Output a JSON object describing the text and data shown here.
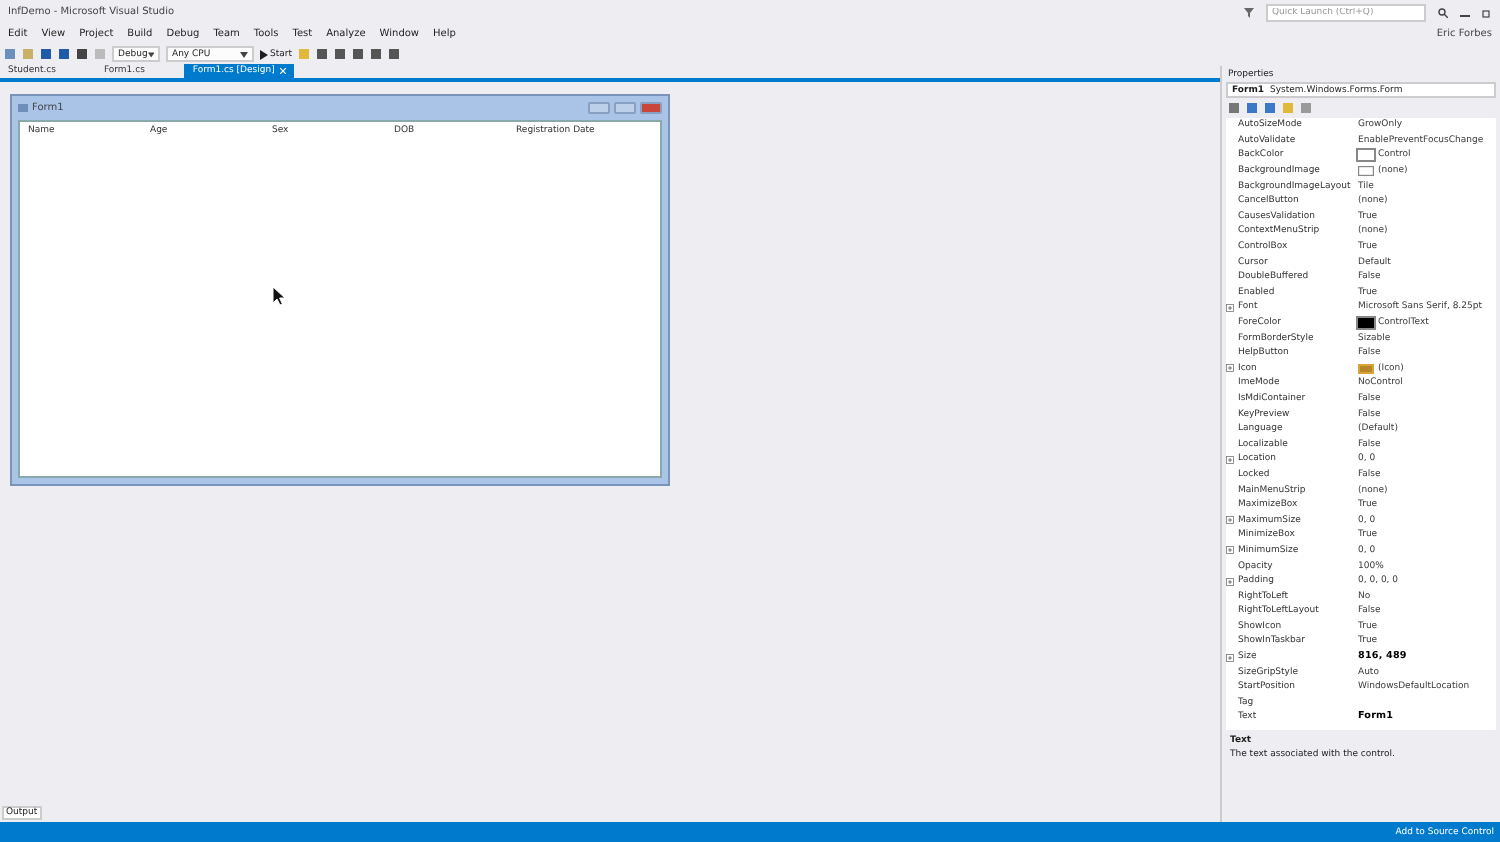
{
  "window": {
    "title": "InfDemo - Microsoft Visual Studio",
    "quick_launch": {
      "placeholder": "Quick Launch (Ctrl+Q)"
    },
    "user": "Eric Forbes"
  },
  "menu": [
    "Edit",
    "View",
    "Project",
    "Build",
    "Debug",
    "Team",
    "Tools",
    "Test",
    "Analyze",
    "Window",
    "Help"
  ],
  "toolbar": {
    "configuration": "Debug",
    "platform": "Any CPU",
    "start": "Start"
  },
  "tabs": [
    {
      "label": "Student.cs",
      "selected": false
    },
    {
      "label": "Form1.cs",
      "selected": false
    },
    {
      "label": "Form1.cs [Design]",
      "selected": true
    }
  ],
  "form": {
    "title": "Form1",
    "columns": [
      "Name",
      "Age",
      "Sex",
      "DOB",
      "Registration Date"
    ]
  },
  "properties": {
    "title": "Properties",
    "object": "Form1",
    "type": "System.Windows.Forms.Form",
    "rows": [
      {
        "name": "AutoSizeMode",
        "value": "GrowOnly",
        "expandable": false,
        "bold": false,
        "kind": "plain"
      },
      {
        "name": "AutoValidate",
        "value": "EnablePreventFocusChange",
        "expandable": false,
        "bold": false
      },
      {
        "name": "BackColor",
        "value": "Control",
        "expandable": false,
        "bold": false,
        "kind": "color",
        "color": "#ffffff"
      },
      {
        "name": "BackgroundImage",
        "value": "(none)",
        "expandable": false,
        "bold": false,
        "kind": "image"
      },
      {
        "name": "BackgroundImageLayout",
        "value": "Tile",
        "expandable": false,
        "bold": false
      },
      {
        "name": "CancelButton",
        "value": "(none)",
        "expandable": false,
        "bold": false
      },
      {
        "name": "CausesValidation",
        "value": "True",
        "expandable": false,
        "bold": false
      },
      {
        "name": "ContextMenuStrip",
        "value": "(none)",
        "expandable": false,
        "bold": false
      },
      {
        "name": "ControlBox",
        "value": "True",
        "expandable": false,
        "bold": false
      },
      {
        "name": "Cursor",
        "value": "Default",
        "expandable": false,
        "bold": false
      },
      {
        "name": "DoubleBuffered",
        "value": "False",
        "expandable": false,
        "bold": false
      },
      {
        "name": "Enabled",
        "value": "True",
        "expandable": false,
        "bold": false
      },
      {
        "name": "Font",
        "value": "Microsoft Sans Serif, 8.25pt",
        "expandable": true,
        "bold": false
      },
      {
        "name": "ForeColor",
        "value": "ControlText",
        "expandable": false,
        "bold": false,
        "kind": "color",
        "color": "#000000"
      },
      {
        "name": "FormBorderStyle",
        "value": "Sizable",
        "expandable": false,
        "bold": false
      },
      {
        "name": "HelpButton",
        "value": "False",
        "expandable": false,
        "bold": false
      },
      {
        "name": "Icon",
        "value": "(Icon)",
        "expandable": true,
        "bold": false,
        "kind": "icon"
      },
      {
        "name": "ImeMode",
        "value": "NoControl",
        "expandable": false,
        "bold": false
      },
      {
        "name": "IsMdiContainer",
        "value": "False",
        "expandable": false,
        "bold": false
      },
      {
        "name": "KeyPreview",
        "value": "False",
        "expandable": false,
        "bold": false
      },
      {
        "name": "Language",
        "value": "(Default)",
        "expandable": false,
        "bold": false
      },
      {
        "name": "Localizable",
        "value": "False",
        "expandable": false,
        "bold": false
      },
      {
        "name": "Location",
        "value": "0, 0",
        "expandable": true,
        "bold": false
      },
      {
        "name": "Locked",
        "value": "False",
        "expandable": false,
        "bold": false
      },
      {
        "name": "MainMenuStrip",
        "value": "(none)",
        "expandable": false,
        "bold": false
      },
      {
        "name": "MaximizeBox",
        "value": "True",
        "expandable": false,
        "bold": false
      },
      {
        "name": "MaximumSize",
        "value": "0, 0",
        "expandable": true,
        "bold": false
      },
      {
        "name": "MinimizeBox",
        "value": "True",
        "expandable": false,
        "bold": false
      },
      {
        "name": "MinimumSize",
        "value": "0, 0",
        "expandable": true,
        "bold": false
      },
      {
        "name": "Opacity",
        "value": "100%",
        "expandable": false,
        "bold": false
      },
      {
        "name": "Padding",
        "value": "0, 0, 0, 0",
        "expandable": true,
        "bold": false
      },
      {
        "name": "RightToLeft",
        "value": "No",
        "expandable": false,
        "bold": false
      },
      {
        "name": "RightToLeftLayout",
        "value": "False",
        "expandable": false,
        "bold": false
      },
      {
        "name": "ShowIcon",
        "value": "True",
        "expandable": false,
        "bold": false
      },
      {
        "name": "ShowInTaskbar",
        "value": "True",
        "expandable": false,
        "bold": false
      },
      {
        "name": "Size",
        "value": "816, 489",
        "expandable": true,
        "bold": true
      },
      {
        "name": "SizeGripStyle",
        "value": "Auto",
        "expandable": false,
        "bold": false
      },
      {
        "name": "StartPosition",
        "value": "WindowsDefaultLocation",
        "expandable": false,
        "bold": false
      },
      {
        "name": "Tag",
        "expandable": false,
        "kind": "plain"
      },
      {
        "name": "Text",
        "value": "Form1",
        "expandable": false,
        "bold": true
      }
    ],
    "description": {
      "title": "Text",
      "text": "The text associated with the control."
    }
  },
  "output_tab": "Output",
  "status_bar": {
    "action": "Add to Source Control"
  }
}
